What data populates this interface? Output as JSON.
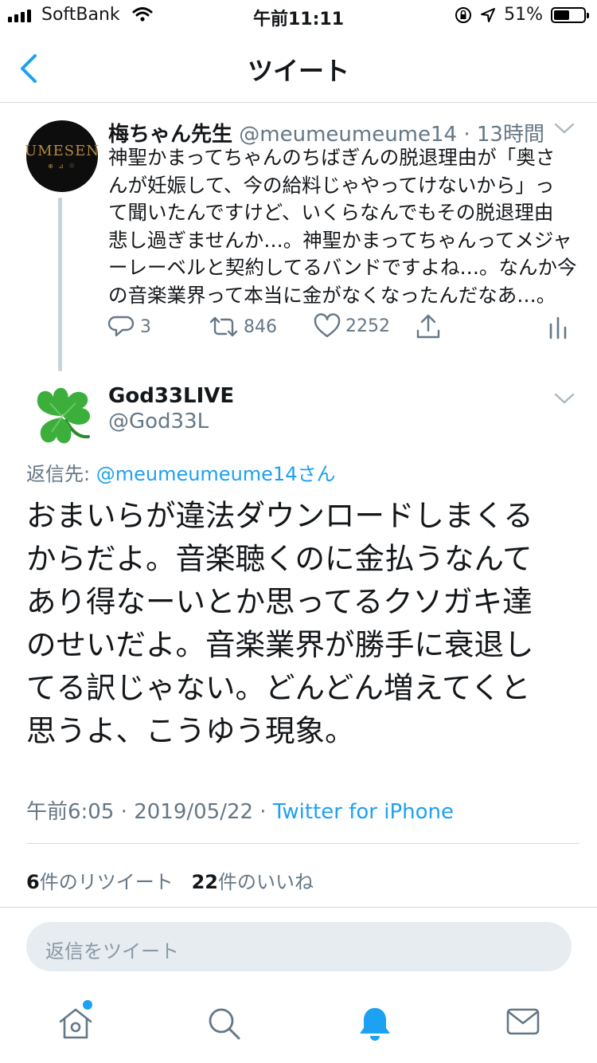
{
  "status": {
    "carrier": "SoftBank",
    "time": "午前11:11",
    "battery": "51%",
    "battery_level": 0.51
  },
  "nav": {
    "title": "ツイート"
  },
  "tweet1": {
    "name": "梅ちゃん先生",
    "handle": "@meumeumeume14",
    "time": "· 13時間",
    "avatar_text": "UMESEN",
    "lines": [
      "神聖かまってちゃんのちばぎんの脱退理由が「奥さ",
      "んが妊娠して、今の給料じゃやってけないから」っ",
      "て聞いたんですけど、いくらなんでもその脱退理由",
      "悲し過ぎませんか…。神聖かまってちゃんってメジャ",
      "ーレーベルと契約してるバンドですよね…。なんか今",
      "の音楽業界って本当に金がなくなったんだなあ…。"
    ],
    "replies": "3",
    "retweets": "846",
    "likes": "2252"
  },
  "tweet2": {
    "name": "God33LIVE",
    "handle": "@God33L",
    "reply_label": "返信先: ",
    "reply_target": "@meumeumeume14さん",
    "lines": [
      "おまいらが違法ダウンロードしまくる",
      "からだよ。音楽聴くのに金払うなんて",
      "あり得なーいとか思ってるクソガキ達",
      "のせいだよ。音楽業界が勝手に衰退し",
      "てる訳じゃない。どんどん増えてくと",
      "思うよ、こうゆう現象。"
    ],
    "time": "午前6:05",
    "date": "2019/05/22",
    "sep": " · ",
    "source": "Twitter for iPhone",
    "retweet_count": "6",
    "retweet_label": "件のリツイート",
    "like_count": "22",
    "like_label": "件のいいね"
  },
  "reply_box": {
    "placeholder": "返信をツイート"
  },
  "tabs": [
    "home-icon",
    "search-icon",
    "notifications-icon",
    "messages-icon"
  ],
  "colors": {
    "accent": "#1da1f2",
    "secondary_text": "#657786",
    "divider": "#d6dbe0"
  }
}
